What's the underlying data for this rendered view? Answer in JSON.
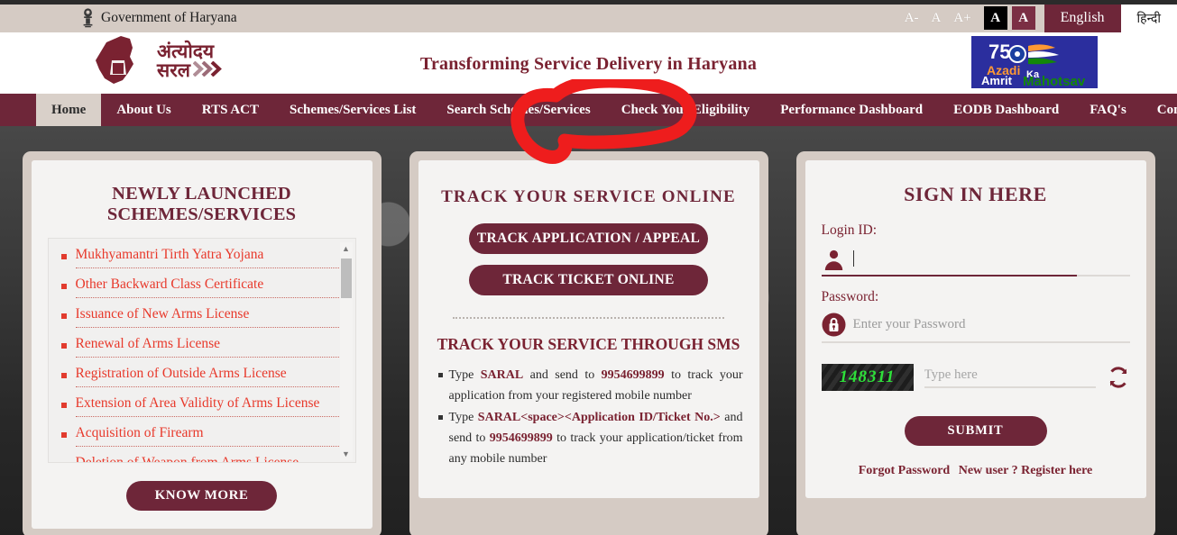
{
  "topbar": {
    "government_label": "Government of Haryana",
    "emblem_icon": "national-emblem-icon",
    "font_decrease": "A-",
    "font_normal": "A",
    "font_increase": "A+",
    "contrast_dark": "A",
    "contrast_maroon": "A",
    "lang_english": "English",
    "lang_hindi": "हिन्दी"
  },
  "header": {
    "logo_hindi_line1": "अंत्योदय",
    "logo_hindi_line2": "सरल",
    "tagline": "Transforming Service Delivery in Haryana",
    "azadi": {
      "number": "75",
      "word1": "Azadi",
      "word2": "Ka",
      "word3": "Amrit",
      "word4": "Mahotsav"
    }
  },
  "nav": {
    "items": [
      {
        "label": "Home",
        "active": true
      },
      {
        "label": "About Us",
        "active": false
      },
      {
        "label": "RTS ACT",
        "active": false
      },
      {
        "label": "Schemes/Services List",
        "active": false
      },
      {
        "label": "Search Schemes/Services",
        "active": false
      },
      {
        "label": "Check Your Eligibility",
        "active": false
      },
      {
        "label": "Performance Dashboard",
        "active": false
      },
      {
        "label": "EODB Dashboard",
        "active": false
      },
      {
        "label": "FAQ's",
        "active": false
      },
      {
        "label": "Contact Us",
        "active": false
      }
    ]
  },
  "annotation": {
    "shape": "hand-drawn-red-circle",
    "target": "Check Your Eligibility",
    "color": "#ee1d1d"
  },
  "schemes_panel": {
    "title": "NEWLY LAUNCHED SCHEMES/SERVICES",
    "items": [
      "Mukhyamantri Tirth Yatra Yojana",
      "Other Backward Class Certificate",
      "Issuance of New Arms License",
      "Renewal of Arms License",
      "Registration of Outside Arms License",
      "Extension of Area Validity of Arms License",
      "Acquisition of Firearm",
      "Deletion of Weapon from Arms License"
    ],
    "know_more_label": "KNOW MORE",
    "scrollbar": {
      "up_icon": "caret-up-icon",
      "down_icon": "caret-down-icon"
    }
  },
  "track_panel": {
    "title": "TRACK YOUR SERVICE ONLINE",
    "track_application_label": "TRACK APPLICATION / APPEAL",
    "track_ticket_label": "TRACK TICKET ONLINE",
    "sms_title": "TRACK YOUR SERVICE THROUGH SMS",
    "sms_items": [
      {
        "part1": "Type ",
        "bold1": "SARAL",
        "part2": " and send to ",
        "bold2": "9954699899",
        "part3": " to track your application from your registered mobile number"
      },
      {
        "part1": "Type ",
        "bold1": "SARAL<space><Application ID/Ticket No.>",
        "part2": " and send to ",
        "bold2": "9954699899",
        "part3": " to track your application/ticket from any mobile number"
      }
    ]
  },
  "signin_panel": {
    "title": "SIGN IN HERE",
    "login_label": "Login ID:",
    "login_value": "",
    "login_placeholder": "",
    "login_icon": "user-avatar-icon",
    "password_label": "Password:",
    "password_value": "",
    "password_placeholder": "Enter your Password",
    "password_icon": "lock-icon",
    "captcha_value": "148311",
    "captcha_placeholder": "Type here",
    "captcha_input_value": "",
    "refresh_icon": "refresh-icon",
    "submit_label": "SUBMIT",
    "forgot_label": "Forgot Password",
    "register_label": "New user ? Register here"
  },
  "colors": {
    "maroon": "#6e2639",
    "maroon_text": "#7a2231",
    "beige": "#d5cbc4",
    "scheme_red": "#e8392b",
    "captcha_green": "#2ee03a",
    "annotation_red": "#ee1d1d"
  }
}
